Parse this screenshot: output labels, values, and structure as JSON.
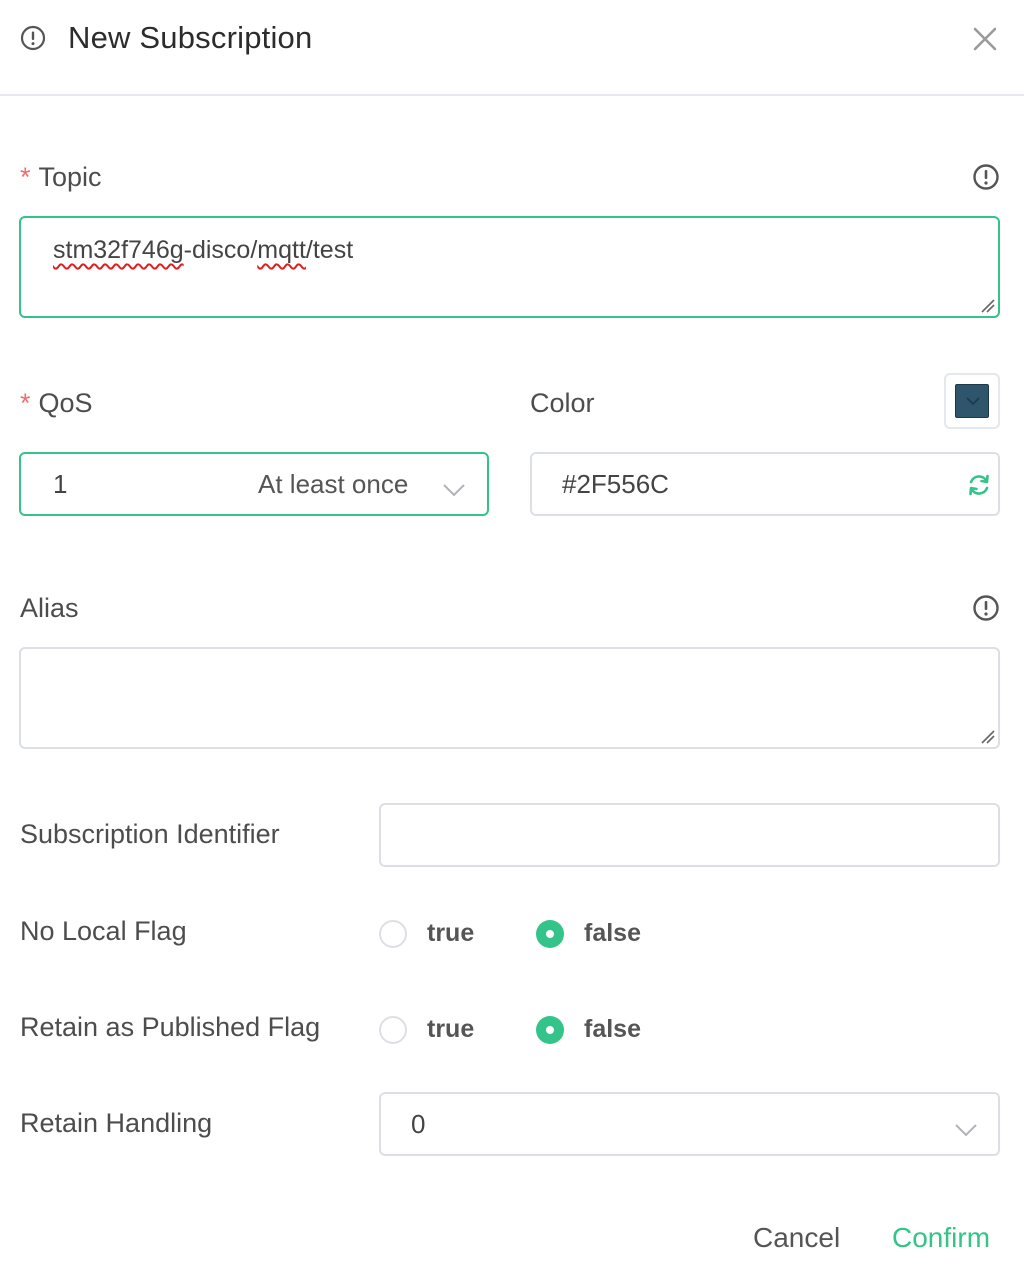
{
  "dialog": {
    "title": "New Subscription",
    "icons": {
      "title": "info-circle-icon",
      "close": "close-icon"
    }
  },
  "topic": {
    "label": "Topic",
    "required": "*",
    "value_parts": [
      "stm32f746g",
      "-disco/",
      "mqtt",
      "/test"
    ],
    "info_icon": "info-circle-icon"
  },
  "qos": {
    "label": "QoS",
    "required": "*",
    "value": "1",
    "description": "At least once"
  },
  "color": {
    "label": "Color",
    "value": "#2F556C",
    "swatch": "#2F556C",
    "refresh_icon": "refresh-icon"
  },
  "alias": {
    "label": "Alias",
    "value": "",
    "info_icon": "info-circle-icon"
  },
  "subscription_identifier": {
    "label": "Subscription Identifier",
    "value": ""
  },
  "no_local_flag": {
    "label": "No Local Flag",
    "options": [
      "true",
      "false"
    ],
    "selected": "false"
  },
  "retain_as_published_flag": {
    "label": "Retain as Published Flag",
    "options": [
      "true",
      "false"
    ],
    "selected": "false"
  },
  "retain_handling": {
    "label": "Retain Handling",
    "value": "0"
  },
  "footer": {
    "cancel_label": "Cancel",
    "confirm_label": "Confirm"
  },
  "colors": {
    "accent": "#34C388",
    "required": "#F56C6C",
    "border": "#DCDFE6"
  }
}
